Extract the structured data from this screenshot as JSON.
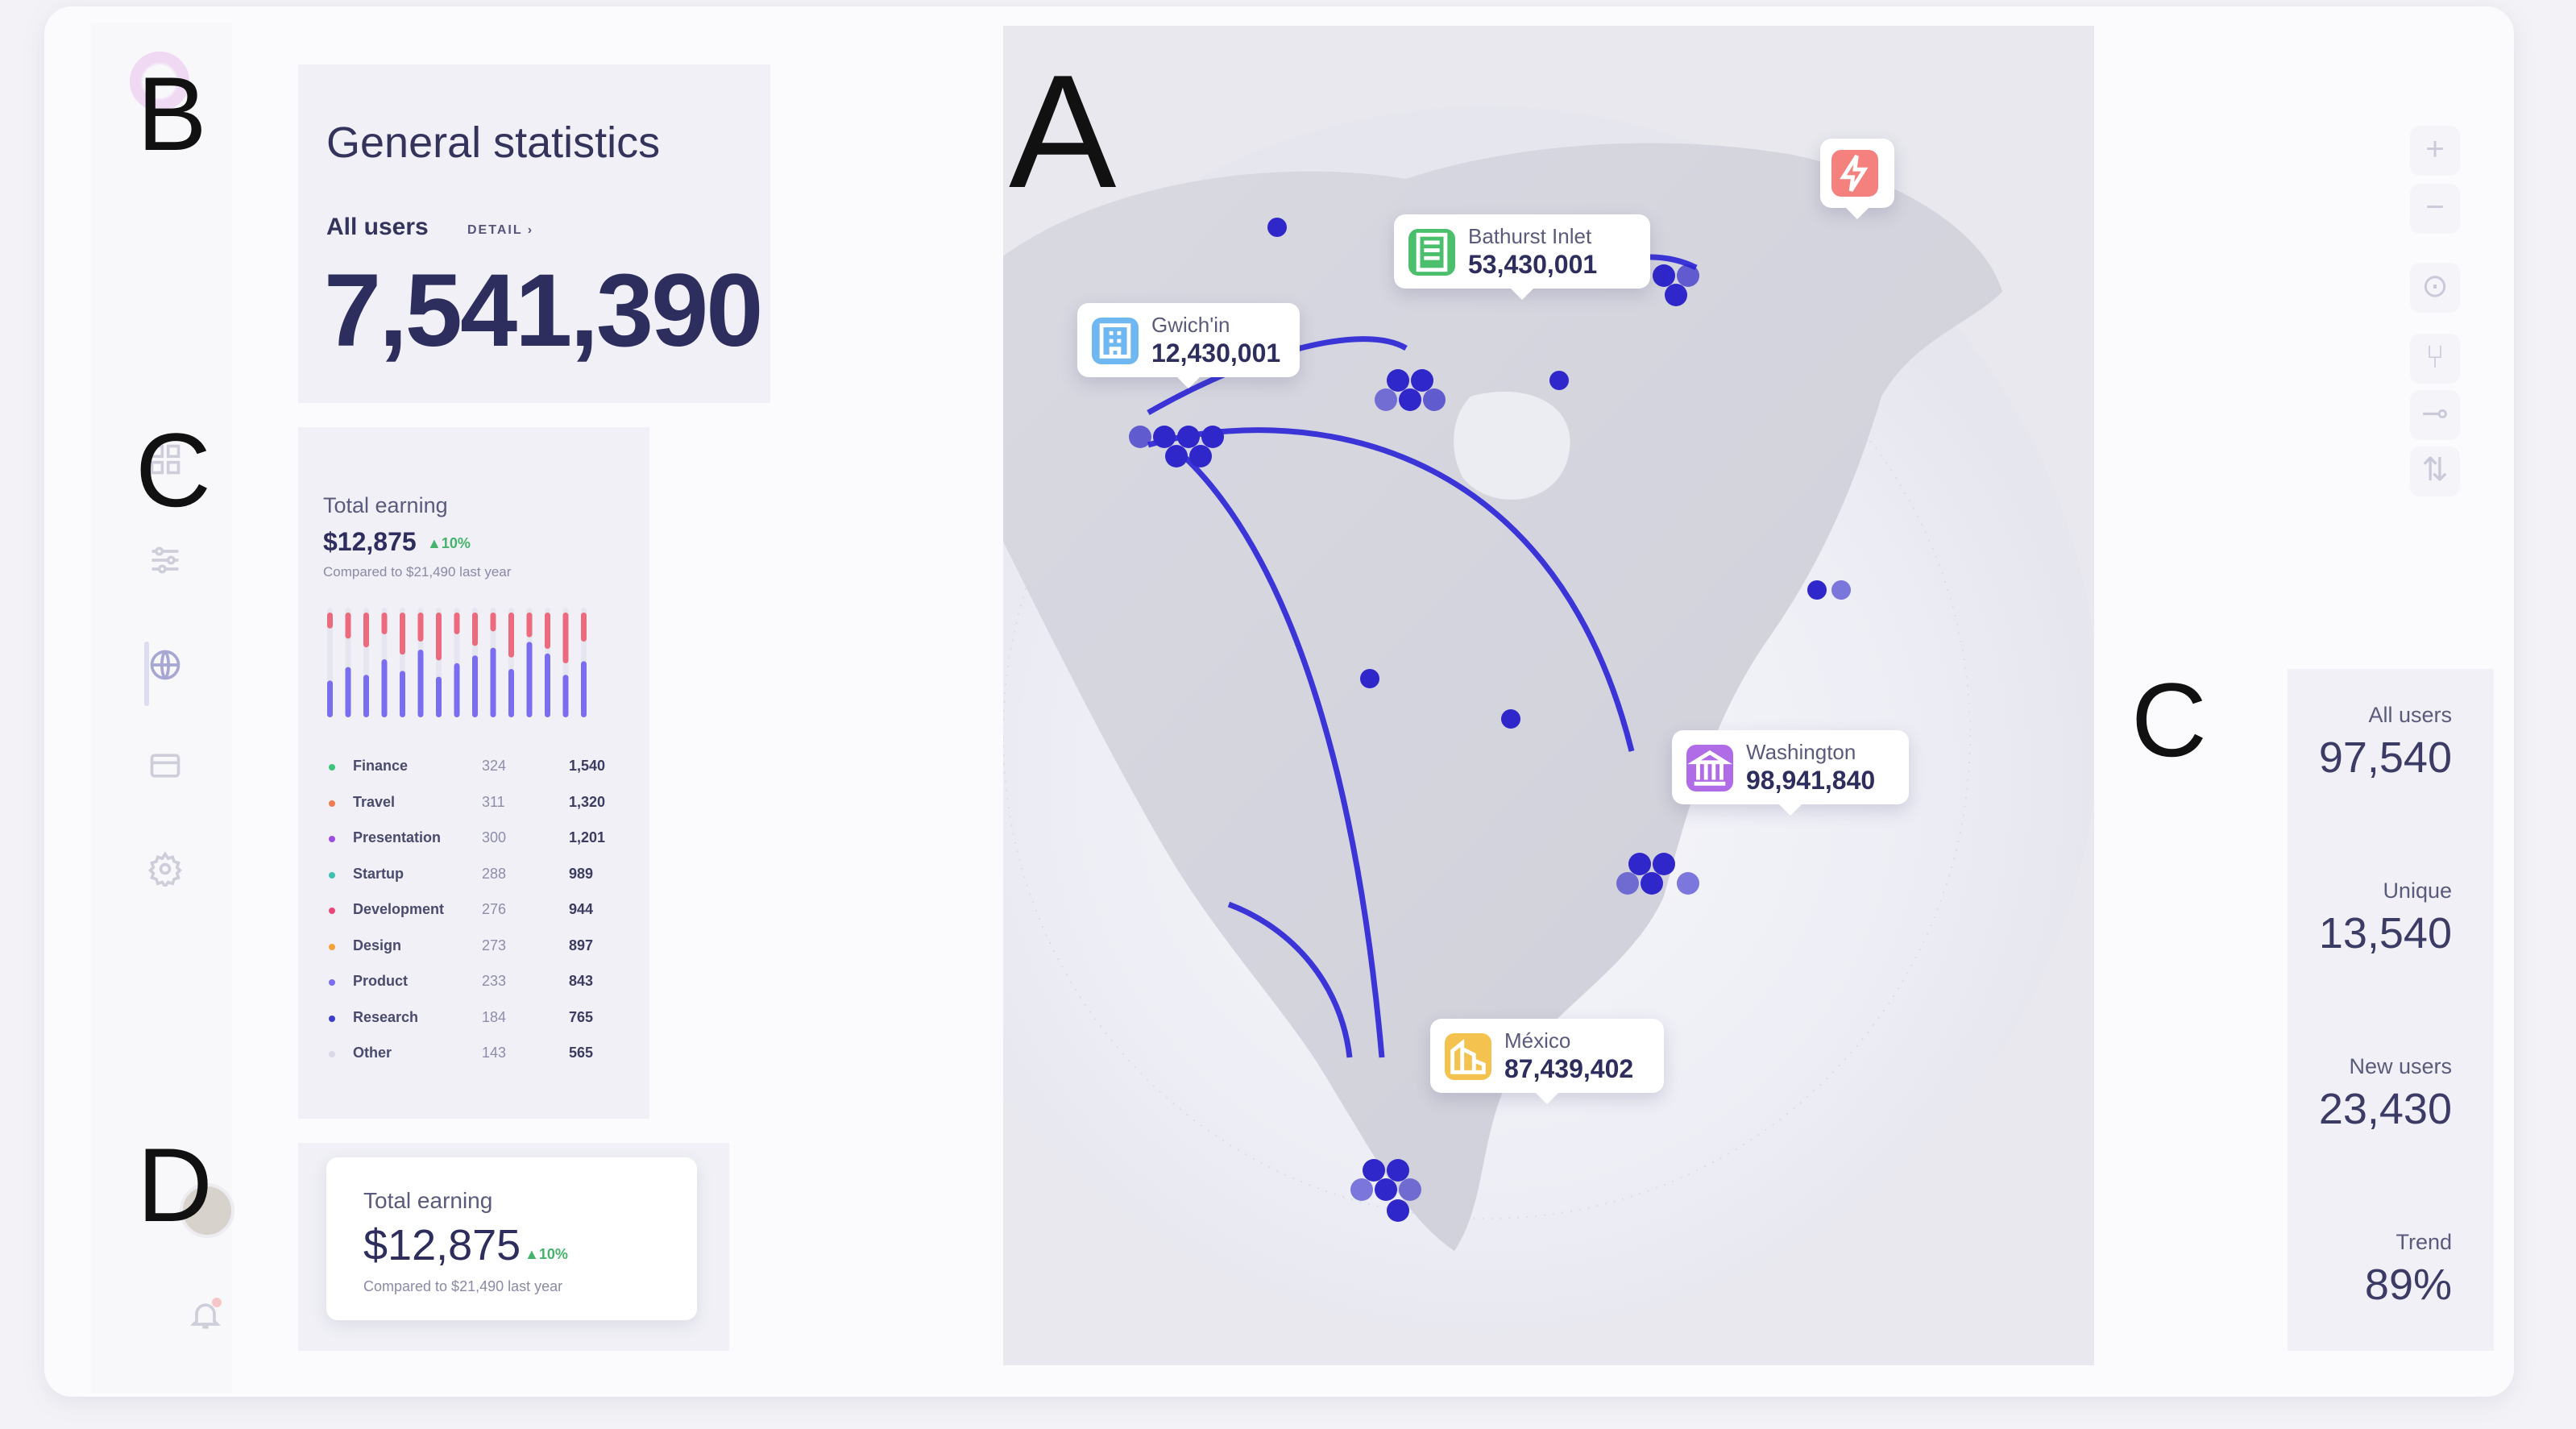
{
  "overlay_letters": {
    "a": "A",
    "b": "B",
    "c1": "C",
    "c2": "C",
    "d": "D"
  },
  "general": {
    "title": "General statistics",
    "all_users_label": "All users",
    "detail_label": "DETAIL",
    "all_users_value": "7,541,390"
  },
  "earning": {
    "title": "Total earning",
    "value": "$12,875",
    "percent": "10%",
    "compare": "Compared to $21,490 last year",
    "legend": [
      {
        "name": "Finance",
        "a": "324",
        "b": "1,540",
        "color": "#3fc27a"
      },
      {
        "name": "Travel",
        "a": "311",
        "b": "1,320",
        "color": "#f07a52"
      },
      {
        "name": "Presentation",
        "a": "300",
        "b": "1,201",
        "color": "#9b4ee0"
      },
      {
        "name": "Startup",
        "a": "288",
        "b": "989",
        "color": "#3fbfb0"
      },
      {
        "name": "Development",
        "a": "276",
        "b": "944",
        "color": "#e8477a"
      },
      {
        "name": "Design",
        "a": "273",
        "b": "897",
        "color": "#f4a23a"
      },
      {
        "name": "Product",
        "a": "233",
        "b": "843",
        "color": "#7a6df0"
      },
      {
        "name": "Research",
        "a": "184",
        "b": "765",
        "color": "#3c3ccf"
      },
      {
        "name": "Other",
        "a": "143",
        "b": "565",
        "color": "#d8d8e6"
      }
    ]
  },
  "earning_card": {
    "title": "Total earning",
    "value": "$12,875",
    "percent": "10%",
    "compare": "Compared to $21,490 last year"
  },
  "map": {
    "pins": [
      {
        "name": "Gwich'in",
        "value": "12,430,001",
        "icon_color": "#6fb7f0",
        "icon": "building-icon"
      },
      {
        "name": "Bathurst Inlet",
        "value": "53,430,001",
        "icon_color": "#4bbf6b",
        "icon": "office-icon"
      },
      {
        "name": "Washington",
        "value": "98,941,840",
        "icon_color": "#b06be6",
        "icon": "bank-icon"
      },
      {
        "name": "México",
        "value": "87,439,402",
        "icon_color": "#f4c24e",
        "icon": "city-icon"
      }
    ],
    "alert_icon": "lightning-icon",
    "controls": [
      "+",
      "−",
      "⊙",
      "⑂",
      "⊸",
      "⇅"
    ]
  },
  "stats": [
    {
      "label": "All users",
      "value": "97,540"
    },
    {
      "label": "Unique",
      "value": "13,540"
    },
    {
      "label": "New users",
      "value": "23,430"
    },
    {
      "label": "Trend",
      "value": "89%"
    }
  ],
  "bar_chart": {
    "purple": [
      38,
      52,
      44,
      60,
      48,
      70,
      42,
      56,
      64,
      72,
      50,
      78,
      66,
      44,
      58
    ],
    "red": [
      22,
      36,
      48,
      30,
      58,
      40,
      66,
      30,
      46,
      26,
      62,
      34,
      50,
      70,
      40
    ],
    "purple_color": "#7a6df0",
    "red_color": "#ec6a7d"
  }
}
